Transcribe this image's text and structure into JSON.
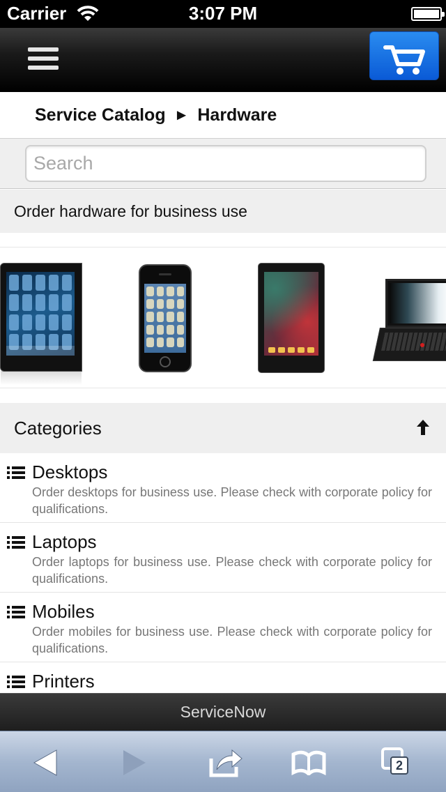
{
  "status_bar": {
    "carrier": "Carrier",
    "time": "3:07 PM"
  },
  "header": {
    "menu_icon": "hamburger-menu-icon",
    "cart_icon": "shopping-cart-icon",
    "cart_color": "#0a6ae0"
  },
  "breadcrumb": {
    "root": "Service Catalog",
    "separator": "►",
    "current": "Hardware"
  },
  "search": {
    "placeholder": "Search",
    "value": ""
  },
  "description": "Order hardware for business use",
  "carousel": {
    "items": [
      {
        "icon": "ipad-image"
      },
      {
        "icon": "iphone-image"
      },
      {
        "icon": "android-tablet-image"
      },
      {
        "icon": "laptop-image"
      }
    ]
  },
  "categories": {
    "title": "Categories",
    "items": [
      {
        "title": "Desktops",
        "description": "Order desktops for business use. Please check with corporate policy for qualifications."
      },
      {
        "title": "Laptops",
        "description": "Order laptops for business use. Please check with corporate policy for qualifications."
      },
      {
        "title": "Mobiles",
        "description": "Order mobiles for business use. Please check with corporate policy for qualifications."
      },
      {
        "title": "Printers",
        "description": ""
      }
    ]
  },
  "footer": {
    "label": "ServiceNow"
  },
  "safari": {
    "tabs_count": "2"
  }
}
